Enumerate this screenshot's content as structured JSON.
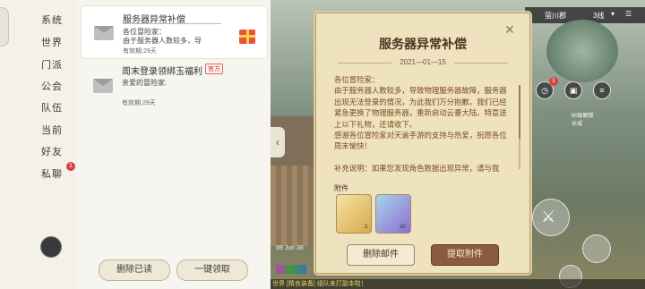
{
  "categories": [
    {
      "label": "系统"
    },
    {
      "label": "世界"
    },
    {
      "label": "门派"
    },
    {
      "label": "公会"
    },
    {
      "label": "队伍"
    },
    {
      "label": "当前"
    },
    {
      "label": "好友"
    },
    {
      "label": "私聊",
      "badge": "1"
    }
  ],
  "mails": [
    {
      "title": "服务器异常补偿",
      "greeting": "各位冒险家：",
      "preview": "由于服务器人数较多，导",
      "expiry": "有效期:29天",
      "icon": "gift-icon"
    },
    {
      "title": "周末登录领绑玉福利",
      "tag": "官方",
      "greeting": "亲爱的冒险家:",
      "expiry": "有效期:29天",
      "icon": "envelope-icon"
    }
  ],
  "list_actions": {
    "delete_read": "删除已读",
    "claim_all": "一键领取"
  },
  "dialog": {
    "title": "服务器异常补偿",
    "date": "2021—01—15",
    "body": "各位冒险家：\n由于服务器人数较多，导致物理服务器故障，服务器出现无法登录的情况，为此我们万分抱歉。我们已经紧急更换了物理服务器，重新启动云垂大陆。特意送上以下礼物，还请收下。\n感谢各位冒险家对天谕手游的支持与热爱，祝愿各位周末愉快！\n\n补充说明：如果您发现角色数据出现异常，请与我",
    "attachments_label": "附件",
    "attachments": [
      {
        "icon": "scroll-item-icon",
        "qty": "2"
      },
      {
        "icon": "ticket-item-icon",
        "qty": "20"
      }
    ],
    "delete_btn": "删除邮件",
    "claim_btn": "提取附件"
  },
  "hud": {
    "location": "萤川郡",
    "channel": "3线",
    "badge_count": "1",
    "map_tag": "60级解锁\n长城",
    "timestamp": "59 Jun 38",
    "chat": "世界 [精良装备] 组队来打副本啦！"
  },
  "colors": {
    "parchment": "#efe2bf",
    "dark_btn": "#8c5a3c",
    "accent_red": "#d94141"
  }
}
